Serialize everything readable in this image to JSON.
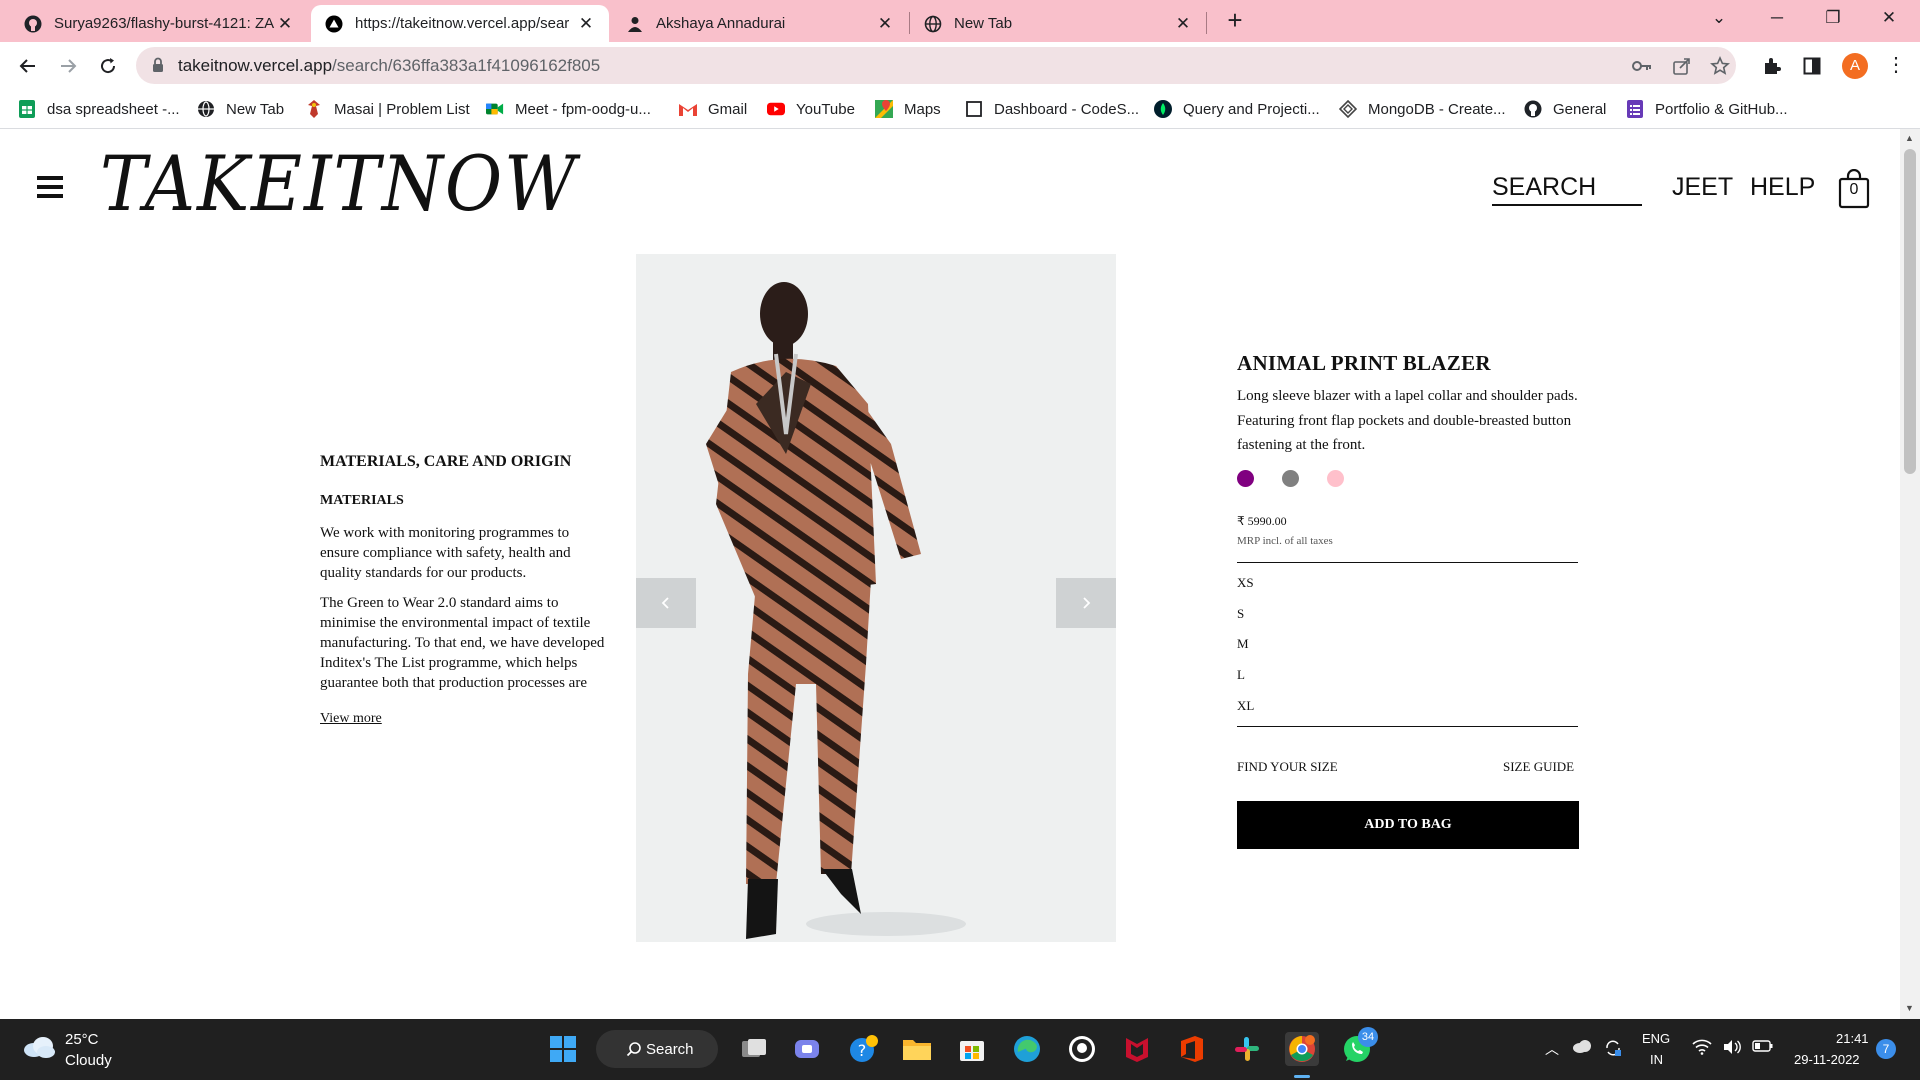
{
  "browser": {
    "tabs": [
      {
        "title": "Surya9263/flashy-burst-4121: ZA",
        "icon": "github-icon"
      },
      {
        "title": "https://takeitnow.vercel.app/sear",
        "icon": "vercel-icon"
      },
      {
        "title": "Akshaya Annadurai",
        "icon": "person-icon"
      },
      {
        "title": "New Tab",
        "icon": "globe-icon"
      }
    ],
    "url_host": "takeitnow.vercel.app",
    "url_path": "/search/636ffa383a1f41096162f805",
    "avatar_letter": "A",
    "bookmarks": [
      {
        "label": "dsa spreadsheet -...",
        "icon": "sheets-icon"
      },
      {
        "label": "New Tab",
        "icon": "globe-icon"
      },
      {
        "label": "Masai | Problem List",
        "icon": "masai-icon"
      },
      {
        "label": "Meet - fpm-oodg-u...",
        "icon": "meet-icon"
      },
      {
        "label": "Gmail",
        "icon": "gmail-icon"
      },
      {
        "label": "YouTube",
        "icon": "youtube-icon"
      },
      {
        "label": "Maps",
        "icon": "maps-icon"
      },
      {
        "label": "Dashboard - CodeS...",
        "icon": "codesignal-icon"
      },
      {
        "label": "Query and Projecti...",
        "icon": "mongodb-leaf-icon"
      },
      {
        "label": "MongoDB - Create...",
        "icon": "diamond-icon"
      },
      {
        "label": "General",
        "icon": "github-icon"
      },
      {
        "label": "Portfolio & GitHub...",
        "icon": "forms-icon"
      }
    ]
  },
  "header": {
    "logo": "TAKEITNOW",
    "search_label": "SEARCH",
    "user_label": "JEET",
    "help_label": "HELP",
    "bag_count": "0"
  },
  "materials": {
    "heading": "MATERIALS, CARE AND ORIGIN",
    "subheading": "MATERIALS",
    "para1": "We work with monitoring programmes to ensure compliance with safety, health and quality standards for our products.",
    "para2": "The Green to Wear 2.0 standard aims to minimise the environmental impact of textile manufacturing. To that end, we have developed Inditex's The List programme, which helps guarantee both that production processes are clean and that our",
    "view_more": "View more"
  },
  "product": {
    "name": "ANIMAL PRINT BLAZER",
    "description": "Long sleeve blazer with a lapel collar and shoulder pads. Featuring front flap pockets and double-breasted button fastening at the front.",
    "colors": [
      "#800080",
      "#808080",
      "#ffc0cb"
    ],
    "price": "₹ 5990.00",
    "mrp_note": "MRP incl. of all taxes",
    "sizes": [
      "XS",
      "S",
      "M",
      "L",
      "XL"
    ],
    "find_size": "FIND YOUR SIZE",
    "size_guide": "SIZE GUIDE",
    "add_to_bag": "ADD TO BAG"
  },
  "taskbar": {
    "temperature": "25°C",
    "weather": "Cloudy",
    "search_label": "Search",
    "whatsapp_badge": "34",
    "lang_line1": "ENG",
    "lang_line2": "IN",
    "time": "21:41",
    "date": "29-11-2022",
    "notification_count": "7"
  }
}
